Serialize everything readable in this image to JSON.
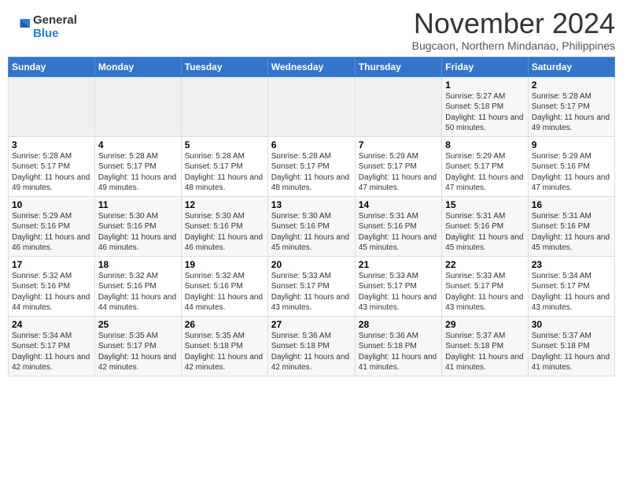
{
  "logo": {
    "general": "General",
    "blue": "Blue"
  },
  "title": "November 2024",
  "subtitle": "Bugcaon, Northern Mindanao, Philippines",
  "days_of_week": [
    "Sunday",
    "Monday",
    "Tuesday",
    "Wednesday",
    "Thursday",
    "Friday",
    "Saturday"
  ],
  "weeks": [
    [
      {
        "day": "",
        "info": ""
      },
      {
        "day": "",
        "info": ""
      },
      {
        "day": "",
        "info": ""
      },
      {
        "day": "",
        "info": ""
      },
      {
        "day": "",
        "info": ""
      },
      {
        "day": "1",
        "info": "Sunrise: 5:27 AM\nSunset: 5:18 PM\nDaylight: 11 hours and 50 minutes."
      },
      {
        "day": "2",
        "info": "Sunrise: 5:28 AM\nSunset: 5:17 PM\nDaylight: 11 hours and 49 minutes."
      }
    ],
    [
      {
        "day": "3",
        "info": "Sunrise: 5:28 AM\nSunset: 5:17 PM\nDaylight: 11 hours and 49 minutes."
      },
      {
        "day": "4",
        "info": "Sunrise: 5:28 AM\nSunset: 5:17 PM\nDaylight: 11 hours and 49 minutes."
      },
      {
        "day": "5",
        "info": "Sunrise: 5:28 AM\nSunset: 5:17 PM\nDaylight: 11 hours and 48 minutes."
      },
      {
        "day": "6",
        "info": "Sunrise: 5:28 AM\nSunset: 5:17 PM\nDaylight: 11 hours and 48 minutes."
      },
      {
        "day": "7",
        "info": "Sunrise: 5:29 AM\nSunset: 5:17 PM\nDaylight: 11 hours and 47 minutes."
      },
      {
        "day": "8",
        "info": "Sunrise: 5:29 AM\nSunset: 5:17 PM\nDaylight: 11 hours and 47 minutes."
      },
      {
        "day": "9",
        "info": "Sunrise: 5:29 AM\nSunset: 5:16 PM\nDaylight: 11 hours and 47 minutes."
      }
    ],
    [
      {
        "day": "10",
        "info": "Sunrise: 5:29 AM\nSunset: 5:16 PM\nDaylight: 11 hours and 46 minutes."
      },
      {
        "day": "11",
        "info": "Sunrise: 5:30 AM\nSunset: 5:16 PM\nDaylight: 11 hours and 46 minutes."
      },
      {
        "day": "12",
        "info": "Sunrise: 5:30 AM\nSunset: 5:16 PM\nDaylight: 11 hours and 46 minutes."
      },
      {
        "day": "13",
        "info": "Sunrise: 5:30 AM\nSunset: 5:16 PM\nDaylight: 11 hours and 45 minutes."
      },
      {
        "day": "14",
        "info": "Sunrise: 5:31 AM\nSunset: 5:16 PM\nDaylight: 11 hours and 45 minutes."
      },
      {
        "day": "15",
        "info": "Sunrise: 5:31 AM\nSunset: 5:16 PM\nDaylight: 11 hours and 45 minutes."
      },
      {
        "day": "16",
        "info": "Sunrise: 5:31 AM\nSunset: 5:16 PM\nDaylight: 11 hours and 45 minutes."
      }
    ],
    [
      {
        "day": "17",
        "info": "Sunrise: 5:32 AM\nSunset: 5:16 PM\nDaylight: 11 hours and 44 minutes."
      },
      {
        "day": "18",
        "info": "Sunrise: 5:32 AM\nSunset: 5:16 PM\nDaylight: 11 hours and 44 minutes."
      },
      {
        "day": "19",
        "info": "Sunrise: 5:32 AM\nSunset: 5:16 PM\nDaylight: 11 hours and 44 minutes."
      },
      {
        "day": "20",
        "info": "Sunrise: 5:33 AM\nSunset: 5:17 PM\nDaylight: 11 hours and 43 minutes."
      },
      {
        "day": "21",
        "info": "Sunrise: 5:33 AM\nSunset: 5:17 PM\nDaylight: 11 hours and 43 minutes."
      },
      {
        "day": "22",
        "info": "Sunrise: 5:33 AM\nSunset: 5:17 PM\nDaylight: 11 hours and 43 minutes."
      },
      {
        "day": "23",
        "info": "Sunrise: 5:34 AM\nSunset: 5:17 PM\nDaylight: 11 hours and 43 minutes."
      }
    ],
    [
      {
        "day": "24",
        "info": "Sunrise: 5:34 AM\nSunset: 5:17 PM\nDaylight: 11 hours and 42 minutes."
      },
      {
        "day": "25",
        "info": "Sunrise: 5:35 AM\nSunset: 5:17 PM\nDaylight: 11 hours and 42 minutes."
      },
      {
        "day": "26",
        "info": "Sunrise: 5:35 AM\nSunset: 5:18 PM\nDaylight: 11 hours and 42 minutes."
      },
      {
        "day": "27",
        "info": "Sunrise: 5:36 AM\nSunset: 5:18 PM\nDaylight: 11 hours and 42 minutes."
      },
      {
        "day": "28",
        "info": "Sunrise: 5:36 AM\nSunset: 5:18 PM\nDaylight: 11 hours and 41 minutes."
      },
      {
        "day": "29",
        "info": "Sunrise: 5:37 AM\nSunset: 5:18 PM\nDaylight: 11 hours and 41 minutes."
      },
      {
        "day": "30",
        "info": "Sunrise: 5:37 AM\nSunset: 5:18 PM\nDaylight: 11 hours and 41 minutes."
      }
    ]
  ]
}
